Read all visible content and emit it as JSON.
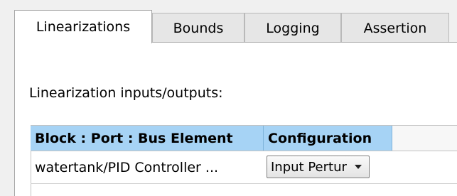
{
  "tabs": [
    {
      "label": "Linearizations",
      "active": true
    },
    {
      "label": "Bounds",
      "active": false
    },
    {
      "label": "Logging",
      "active": false
    },
    {
      "label": "Assertion",
      "active": false
    }
  ],
  "section_label": "Linearization inputs/outputs:",
  "table": {
    "columns": [
      "Block : Port : Bus Element",
      "Configuration"
    ],
    "rows": [
      {
        "block": "watertank/PID Controller ...",
        "configuration": "Input Pertur"
      }
    ]
  },
  "colors": {
    "header_highlight": "#a6d3f5",
    "panel_bg": "#ffffff",
    "window_bg": "#f0f0f0"
  },
  "icons": {
    "dropdown": "chevron-down-icon"
  }
}
